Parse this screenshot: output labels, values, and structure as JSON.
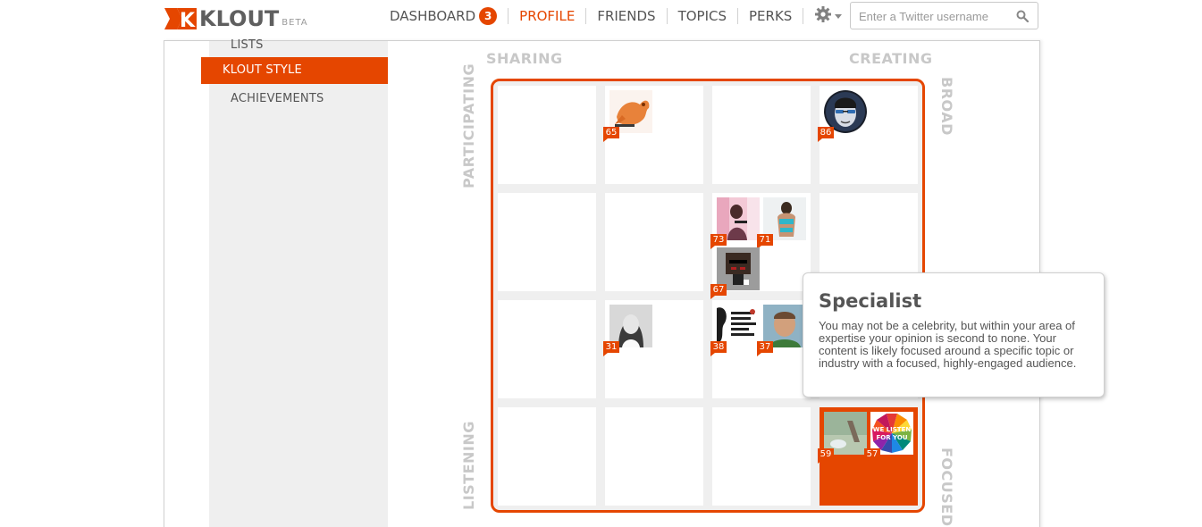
{
  "header": {
    "logo_text": "KLOUT",
    "logo_beta": "BETA",
    "nav": [
      {
        "label": "DASHBOARD",
        "badge": "3"
      },
      {
        "label": "PROFILE"
      },
      {
        "label": "FRIENDS"
      },
      {
        "label": "TOPICS"
      },
      {
        "label": "PERKS"
      }
    ],
    "search": {
      "placeholder": "Enter a Twitter username"
    }
  },
  "colors": {
    "accent": "#e54600",
    "text": "#555555",
    "axis": "#c8c8c8"
  },
  "sidebar": {
    "items": [
      {
        "label": "LISTS"
      },
      {
        "label": "KLOUT STYLE",
        "active": true
      },
      {
        "label": "ACHIEVEMENTS"
      }
    ]
  },
  "matrix": {
    "axis_top_left": "SHARING",
    "axis_top_right": "CREATING",
    "axis_left_top": "PARTICIPATING",
    "axis_left_bottom": "LISTENING",
    "axis_right_top": "BROAD",
    "axis_right_bottom": "FOCUSED",
    "cells": [
      {
        "scores": []
      },
      {
        "scores": [
          "65"
        ]
      },
      {
        "scores": []
      },
      {
        "scores": [
          "86"
        ]
      },
      {
        "scores": []
      },
      {
        "scores": []
      },
      {
        "scores": [
          "73",
          "71",
          "67"
        ]
      },
      {
        "scores": []
      },
      {
        "scores": []
      },
      {
        "scores": [
          "31"
        ]
      },
      {
        "scores": [
          "38",
          "37"
        ]
      },
      {
        "scores": []
      },
      {
        "scores": []
      },
      {
        "scores": []
      },
      {
        "scores": []
      },
      {
        "scores": [
          "59",
          "57"
        ],
        "highlighted": true
      }
    ],
    "thumbnail_text": "WE LISTEN FOR YOU"
  },
  "tooltip": {
    "title": "Specialist",
    "body": "You may not be a celebrity, but within your area of expertise your opinion is second to none. Your content is likely focused around a specific topic or industry with a focused, highly-engaged audience."
  }
}
